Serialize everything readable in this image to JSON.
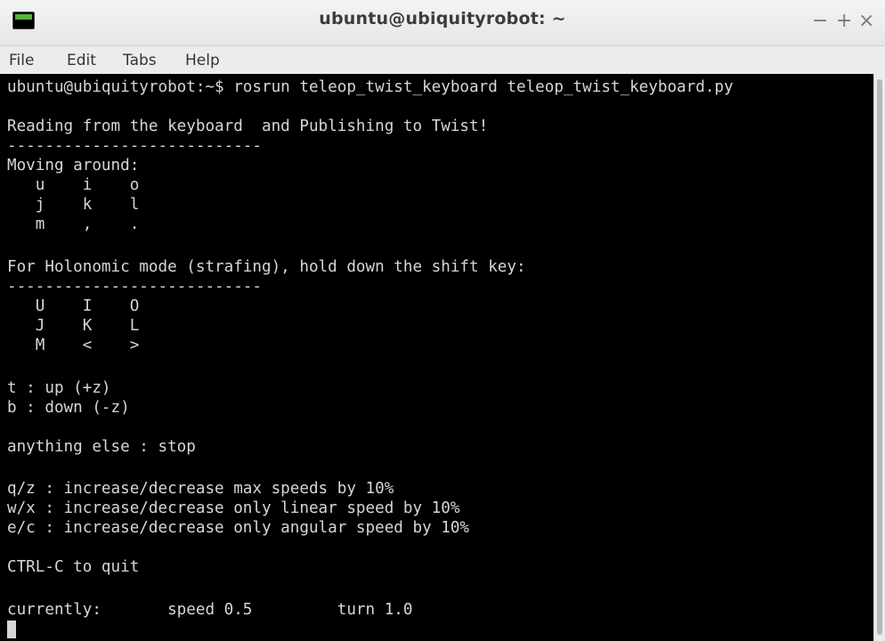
{
  "window": {
    "title": "ubuntu@ubiquityrobot: ~",
    "minimize_glyph": "−",
    "maximize_glyph": "+",
    "close_glyph": "×",
    "app_icon": "terminal-icon"
  },
  "menu": {
    "items": [
      "File",
      "Edit",
      "Tabs",
      "Help"
    ]
  },
  "terminal": {
    "lines": [
      "ubuntu@ubiquityrobot:~$ rosrun teleop_twist_keyboard teleop_twist_keyboard.py",
      "",
      "Reading from the keyboard  and Publishing to Twist!",
      "---------------------------",
      "Moving around:",
      "   u    i    o",
      "   j    k    l",
      "   m    ,    .",
      "",
      "For Holonomic mode (strafing), hold down the shift key:",
      "---------------------------",
      "   U    I    O",
      "   J    K    L",
      "   M    <    >",
      "",
      "t : up (+z)",
      "b : down (-z)",
      "",
      "anything else : stop",
      "",
      "q/z : increase/decrease max speeds by 10%",
      "w/x : increase/decrease only linear speed by 10%",
      "e/c : increase/decrease only angular speed by 10%",
      "",
      "CTRL-C to quit",
      "",
      "currently:       speed 0.5         turn 1.0"
    ]
  },
  "colors": {
    "terminal_bg": "#000000",
    "terminal_fg": "#d6d6d6",
    "chrome_bg": "#ececec",
    "icon_green": "#58b33b"
  }
}
